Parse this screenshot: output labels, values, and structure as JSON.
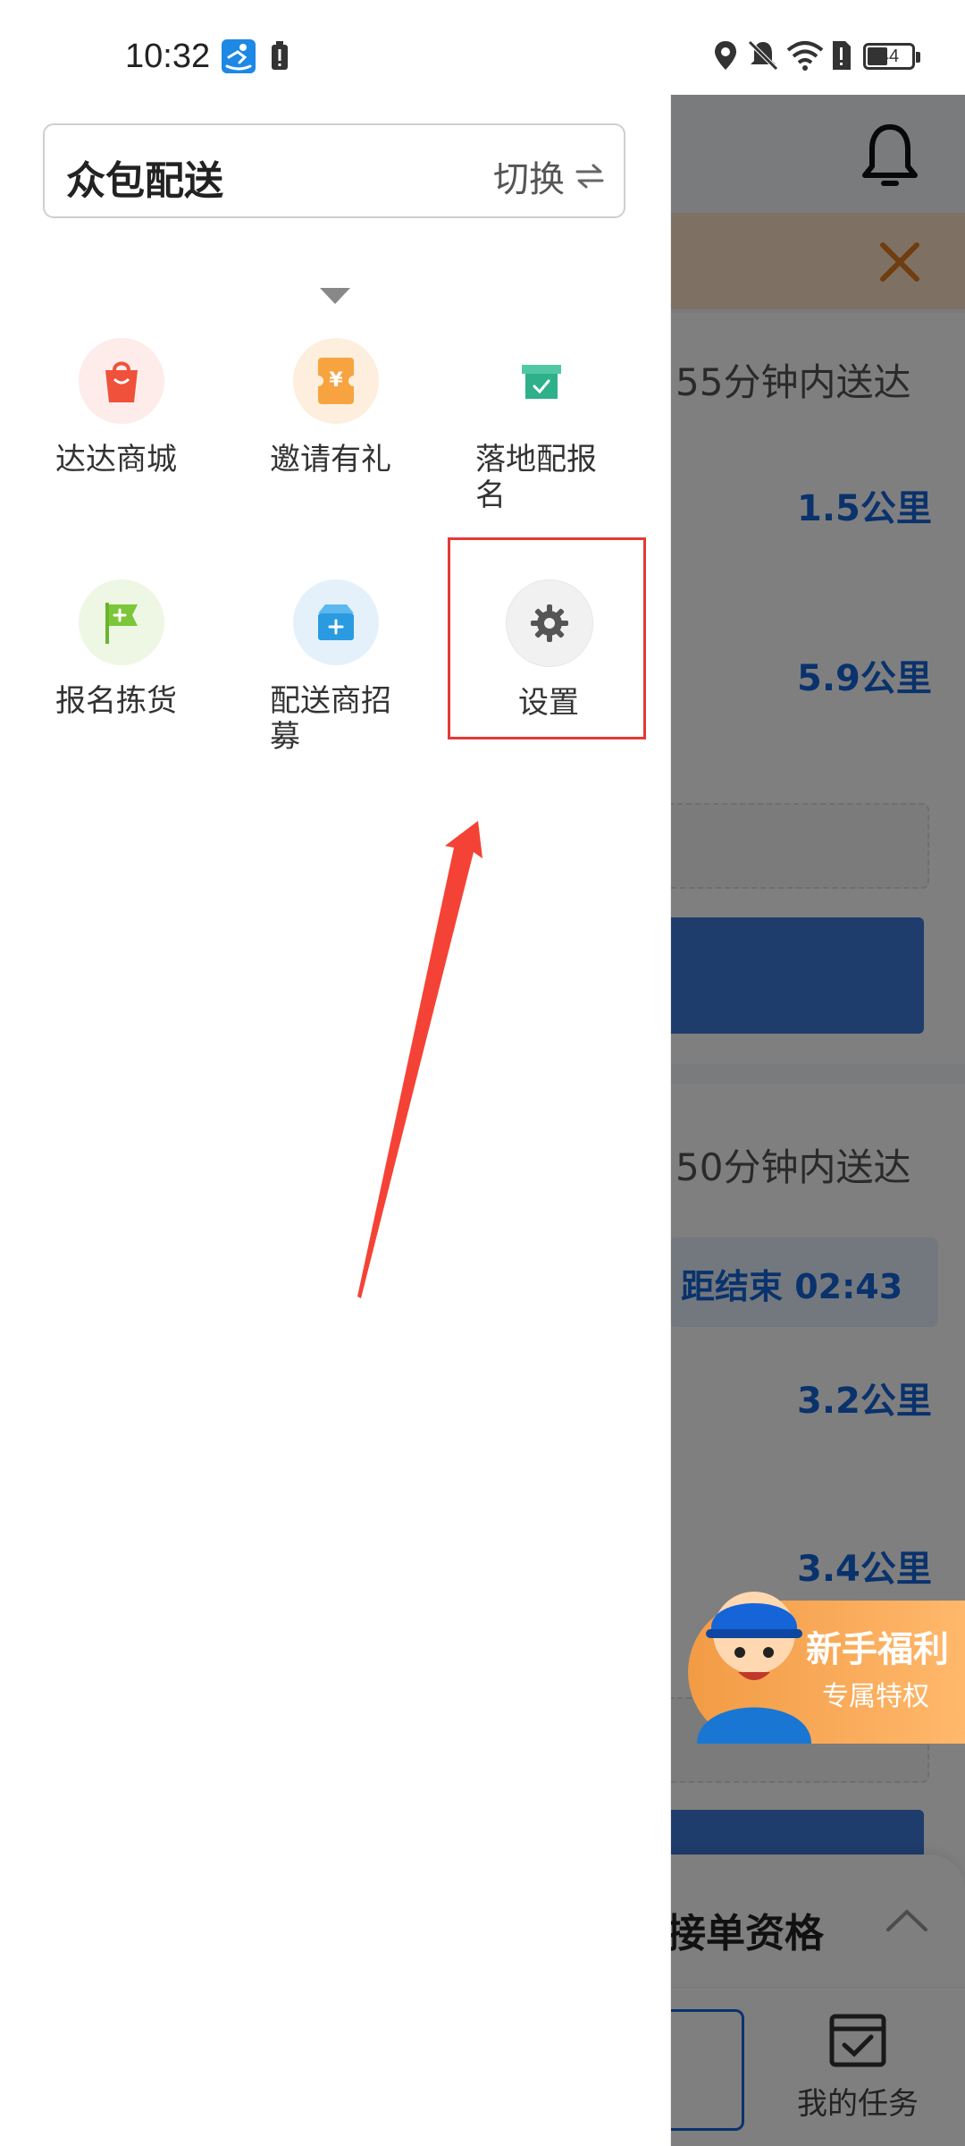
{
  "status_bar": {
    "time": "10:32",
    "battery_level": "44"
  },
  "drawer": {
    "mode_title": "众包配送",
    "switch_label": "切换",
    "switch_icon": "swap-arrows-icon",
    "menu_items": [
      {
        "label": "达达商城",
        "icon": "shopping-bag-icon",
        "bg": "#fdecea"
      },
      {
        "label": "邀请有礼",
        "icon": "ticket-yuan-icon",
        "bg": "#fdeedd"
      },
      {
        "label": "落地配报名",
        "icon": "box-check-icon",
        "bg": "#ffffff"
      },
      {
        "label": "报名拣货",
        "icon": "flag-plus-icon",
        "bg": "#eef7e4"
      },
      {
        "label": "配送商招募",
        "icon": "box-plus-icon",
        "bg": "#e4f1fb"
      },
      {
        "label": "设置",
        "icon": "gear-icon",
        "bg": "#f1f1f1"
      }
    ]
  },
  "background_page": {
    "order1_eta": "55分钟内送达",
    "order1_dist_a": "1.5公里",
    "order1_dist_b": "5.9公里",
    "order2_eta": "50分钟内送达",
    "order2_countdown": "距结束 02:43",
    "order2_dist_a": "3.2公里",
    "order2_dist_b": "3.4公里",
    "promo_title": "新手福利",
    "promo_subtitle": "专属特权",
    "bottom_sheet_title": "接单资格",
    "bottom_nav_tasks": "我的任务"
  },
  "colors": {
    "highlight": "#e53935",
    "distance_blue": "#1565d8",
    "accent_orange": "#f29b45"
  }
}
